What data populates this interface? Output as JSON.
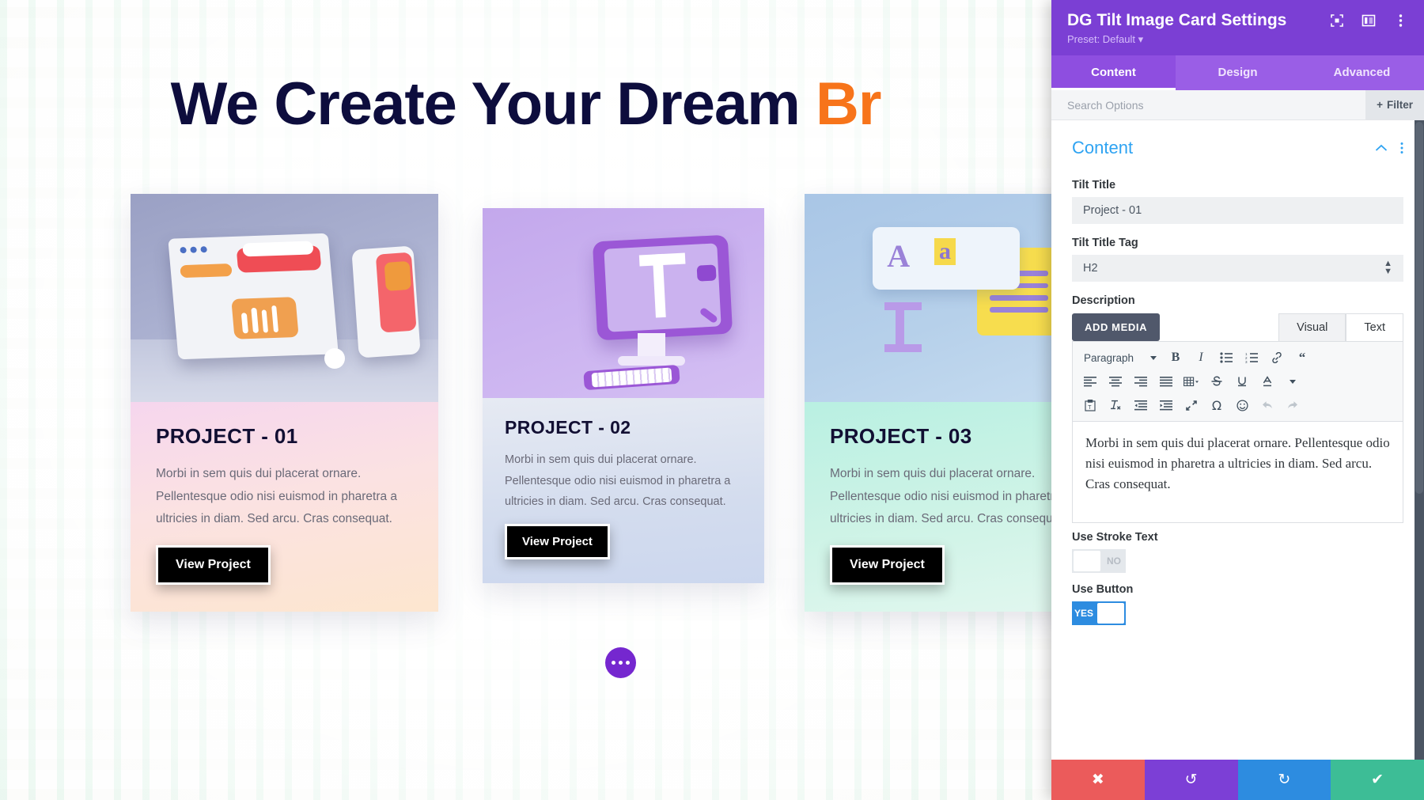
{
  "preview": {
    "heading_main": "We Create Your Dream ",
    "heading_accent": "Br",
    "cards": [
      {
        "title": "PROJECT - 01",
        "desc": "Morbi in sem quis dui placerat ornare. Pellentesque odio nisi euismod in pharetra a ultricies in diam. Sed arcu. Cras consequat.",
        "button": "View Project",
        "image_name": "3d-dashboard-and-phone-render"
      },
      {
        "title": "PROJECT - 02",
        "desc": "Morbi in sem quis dui placerat ornare. Pellentesque odio nisi euismod in pharetra a ultricies in diam. Sed arcu. Cras consequat.",
        "button": "View Project",
        "image_name": "3d-purple-monitor-typography-render"
      },
      {
        "title": "PROJECT - 03",
        "desc": "Morbi in sem quis dui placerat ornare. Pellentesque odio nisi euismod in pharetra a ultricies in diam. Sed arcu. Cras consequat.",
        "button": "View Project",
        "image_name": "3d-typography-aa-panel-render"
      }
    ],
    "more_button_label": "•••"
  },
  "panel": {
    "title": "DG Tilt Image Card Settings",
    "preset": "Preset: Default",
    "header_icons": [
      "focus-target-icon",
      "layout-columns-icon",
      "kebab-menu-icon"
    ],
    "tabs": [
      {
        "label": "Content",
        "active": true
      },
      {
        "label": "Design",
        "active": false
      },
      {
        "label": "Advanced",
        "active": false
      }
    ],
    "search": {
      "placeholder": "Search Options",
      "value": ""
    },
    "filter_label": "Filter",
    "section": {
      "title": "Content"
    },
    "fields": {
      "tilt_title": {
        "label": "Tilt Title",
        "value": "Project - 01"
      },
      "tilt_title_tag": {
        "label": "Tilt Title Tag",
        "value": "H2"
      },
      "description": {
        "label": "Description"
      }
    },
    "editor": {
      "add_media": "ADD MEDIA",
      "tabs": [
        {
          "label": "Visual",
          "active": true
        },
        {
          "label": "Text",
          "active": false
        }
      ],
      "format_select": "Paragraph",
      "toolbar_row1": [
        "bold-icon",
        "italic-icon",
        "bullet-list-icon",
        "numbered-list-icon",
        "link-icon",
        "blockquote-icon"
      ],
      "toolbar_row2": [
        "align-left-icon",
        "align-center-icon",
        "align-right-icon",
        "align-justify-icon",
        "table-icon",
        "strikethrough-icon",
        "underline-icon",
        "text-color-icon"
      ],
      "toolbar_row3": [
        "paste-as-text-icon",
        "clear-formatting-icon",
        "outdent-icon",
        "indent-icon",
        "fullscreen-icon",
        "special-character-icon",
        "emoji-icon",
        "undo-icon",
        "redo-icon"
      ],
      "body_text": "Morbi in sem quis dui placerat ornare. Pellentesque odio nisi euismod in pharetra a ultricies in diam. Sed arcu. Cras consequat."
    },
    "toggles": [
      {
        "label": "Use Stroke Text",
        "value": "NO",
        "on": false
      },
      {
        "label": "Use Button",
        "value": "YES",
        "on": true
      }
    ],
    "footer_buttons": [
      {
        "name": "close-button",
        "icon": "✖",
        "color": "#eb5b5b"
      },
      {
        "name": "undo-button",
        "icon": "↺",
        "color": "#7c3fd6"
      },
      {
        "name": "redo-button",
        "icon": "↻",
        "color": "#2d8ce0"
      },
      {
        "name": "save-button",
        "icon": "✔",
        "color": "#3dbd96"
      }
    ]
  }
}
